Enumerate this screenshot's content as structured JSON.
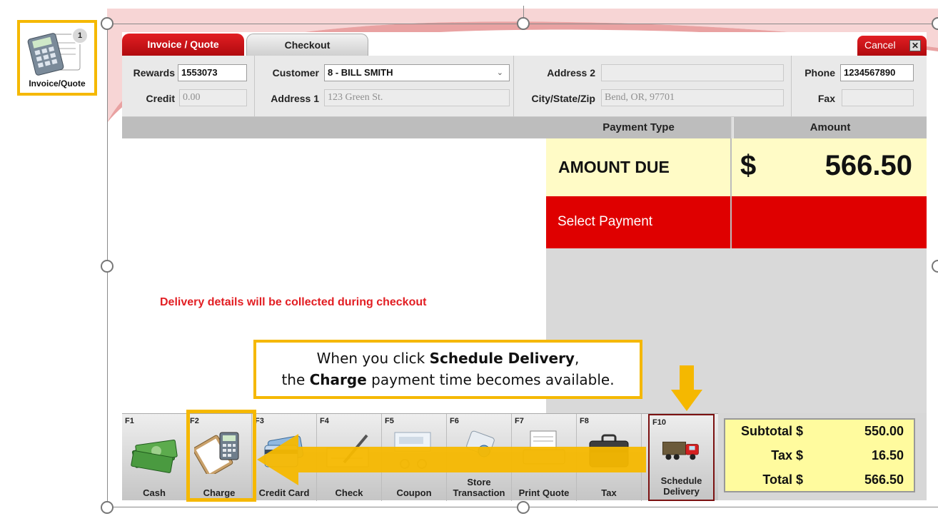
{
  "desktop_icon": {
    "label": "Invoice/Quote",
    "badge": "1",
    "icon": "calculator-icon"
  },
  "tabs": {
    "invoice": "Invoice / Quote",
    "checkout": "Checkout",
    "cancel": "Cancel",
    "cancel_icon": "close-icon"
  },
  "customer_form": {
    "rewards_label": "Rewards",
    "rewards_value": "1553073",
    "credit_label": "Credit",
    "credit_value": "0.00",
    "customer_label": "Customer",
    "customer_value": "8 - BILL SMITH",
    "address1_label": "Address 1",
    "address1_value": "123 Green St.",
    "address2_label": "Address 2",
    "address2_value": "",
    "csz_label": "City/State/Zip",
    "csz_value": "Bend, OR, 97701",
    "phone_label": "Phone",
    "phone_value": "1234567890",
    "fax_label": "Fax",
    "fax_value": ""
  },
  "payment": {
    "type_header": "Payment Type",
    "amount_header": "Amount",
    "due_label": "AMOUNT DUE",
    "currency": "$",
    "due_amount": "566.50",
    "select_label": "Select Payment"
  },
  "delivery_message": "Delivery details will be collected during checkout",
  "toolbar": [
    {
      "key": "F1",
      "label": "Cash",
      "icon": "cash-icon"
    },
    {
      "key": "F2",
      "label": "Charge",
      "icon": "clipboard-calculator-icon"
    },
    {
      "key": "F3",
      "label": "Credit Card",
      "icon": "credit-card-icon"
    },
    {
      "key": "F4",
      "label": "Check",
      "icon": "check-pen-icon"
    },
    {
      "key": "F5",
      "label": "Coupon",
      "icon": "coupon-icon"
    },
    {
      "key": "F6",
      "label": "Store Transaction",
      "icon": "store-transaction-icon"
    },
    {
      "key": "F7",
      "label": "Print Quote",
      "icon": "printer-icon"
    },
    {
      "key": "F8",
      "label": "Tax",
      "icon": "briefcase-icon"
    },
    {
      "key": "F10",
      "label": "Schedule Delivery",
      "icon": "delivery-truck-icon"
    }
  ],
  "totals": {
    "subtotal_label": "Subtotal $",
    "subtotal": "550.00",
    "tax_label": "Tax $",
    "tax": "16.50",
    "total_label": "Total $",
    "total": "566.50"
  },
  "callout": {
    "l1_pre": "When you click ",
    "l1_bold": "Schedule Delivery",
    "l1_post": ",",
    "l2_pre": "the ",
    "l2_bold": "Charge",
    "l2_post": " payment time becomes available."
  },
  "colors": {
    "accent_red": "#e21e23",
    "highlight_yellow": "#f5b800",
    "due_bg": "#fffbc6",
    "pay_red": "#df0000",
    "totals_bg": "#fffb9e"
  }
}
